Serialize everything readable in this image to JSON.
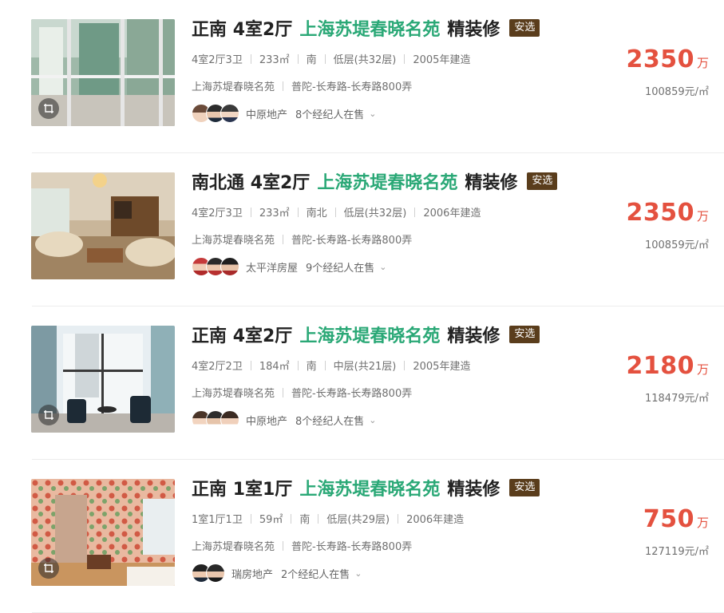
{
  "listings": [
    {
      "orientation": "正南",
      "layout": "4室2厅",
      "community": "上海苏堤春晓名苑",
      "decoration": "精装修",
      "tag": "安选",
      "meta": [
        "4室2厅3卫",
        "233㎡",
        "南",
        "低层(共32层)",
        "2005年建造"
      ],
      "address": [
        "上海苏堤春晓名苑",
        "普陀-长寿路-长寿路800弄"
      ],
      "agency": "中原地产",
      "agents": "8个经纪人在售",
      "price": "2350",
      "price_unit": "万",
      "unit_price": "100859元/㎡",
      "has_vr_icon": true
    },
    {
      "orientation": "南北通",
      "layout": "4室2厅",
      "community": "上海苏堤春晓名苑",
      "decoration": "精装修",
      "tag": "安选",
      "meta": [
        "4室2厅3卫",
        "233㎡",
        "南北",
        "低层(共32层)",
        "2006年建造"
      ],
      "address": [
        "上海苏堤春晓名苑",
        "普陀-长寿路-长寿路800弄"
      ],
      "agency": "太平洋房屋",
      "agents": "9个经纪人在售",
      "price": "2350",
      "price_unit": "万",
      "unit_price": "100859元/㎡",
      "has_vr_icon": false
    },
    {
      "orientation": "正南",
      "layout": "4室2厅",
      "community": "上海苏堤春晓名苑",
      "decoration": "精装修",
      "tag": "安选",
      "meta": [
        "4室2厅2卫",
        "184㎡",
        "南",
        "中层(共21层)",
        "2005年建造"
      ],
      "address": [
        "上海苏堤春晓名苑",
        "普陀-长寿路-长寿路800弄"
      ],
      "agency": "中原地产",
      "agents": "8个经纪人在售",
      "price": "2180",
      "price_unit": "万",
      "unit_price": "118479元/㎡",
      "has_vr_icon": true
    },
    {
      "orientation": "正南",
      "layout": "1室1厅",
      "community": "上海苏堤春晓名苑",
      "decoration": "精装修",
      "tag": "安选",
      "meta": [
        "1室1厅1卫",
        "59㎡",
        "南",
        "低层(共29层)",
        "2006年建造"
      ],
      "address": [
        "上海苏堤春晓名苑",
        "普陀-长寿路-长寿路800弄"
      ],
      "agency": "瑞房地产",
      "agents": "2个经纪人在售",
      "price": "750",
      "price_unit": "万",
      "unit_price": "127119元/㎡",
      "has_vr_icon": true
    }
  ],
  "colors": {
    "community_green": "#2aa876",
    "price_red": "#e4513f",
    "tag_brown": "#5a3d1c"
  }
}
